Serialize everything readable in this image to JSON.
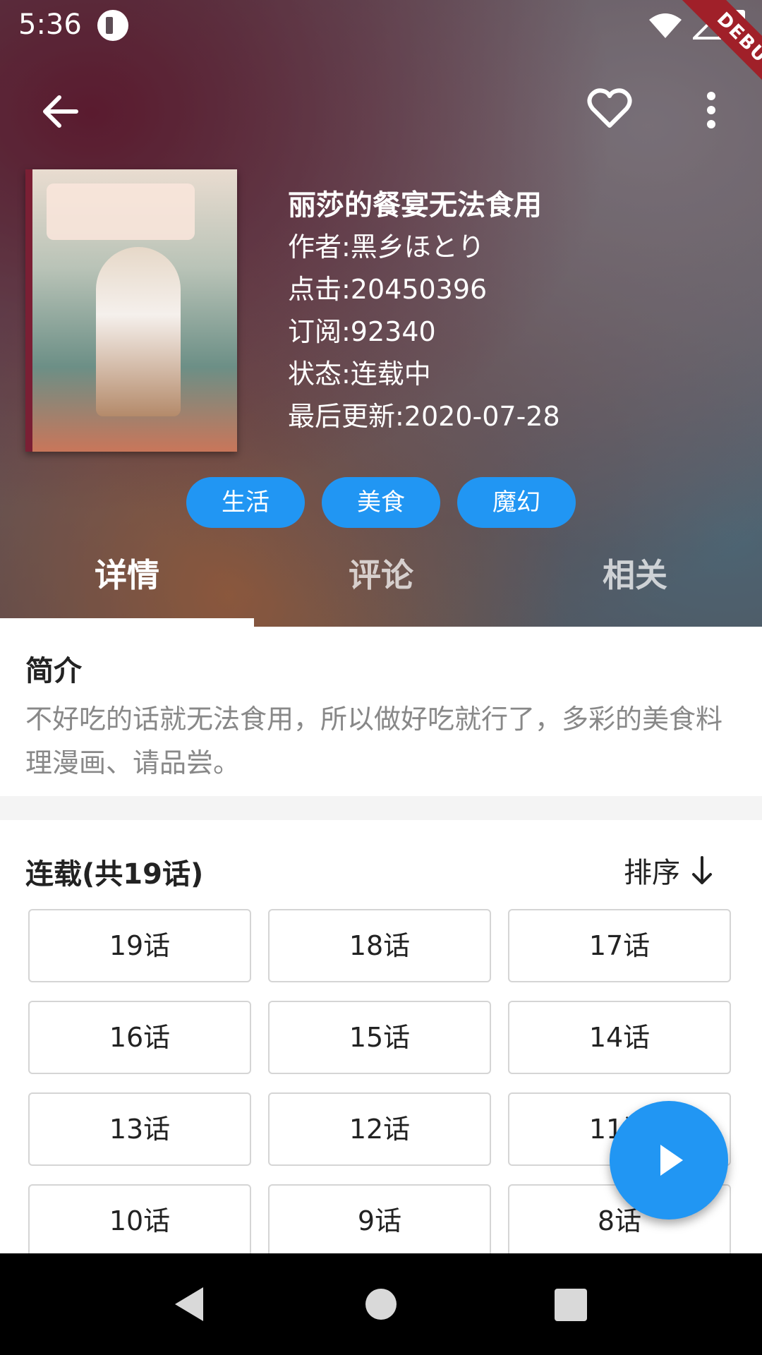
{
  "status_bar": {
    "time": "5:36",
    "debug_label": "DEBUG"
  },
  "app_bar": {
    "back_icon": "arrow-left-icon",
    "favorite_icon": "heart-outline-icon",
    "more_icon": "more-vert-icon"
  },
  "comic": {
    "title": "丽莎的餐宴无法食用",
    "author": "作者:黑乡ほとり",
    "clicks": "点击:20450396",
    "subscriptions": "订阅:92340",
    "status": "状态:连载中",
    "last_update": "最后更新:2020-07-28"
  },
  "tags": [
    "生活",
    "美食",
    "魔幻"
  ],
  "tabs": [
    {
      "label": "详情",
      "active": true
    },
    {
      "label": "评论",
      "active": false
    },
    {
      "label": "相关",
      "active": false
    }
  ],
  "synopsis": {
    "heading": "简介",
    "text": "不好吃的话就无法食用，所以做好吃就行了，多彩的美食料理漫画、请品尝。"
  },
  "chapters": {
    "heading": "连载(共19话)",
    "sort_label": "排序",
    "sort_icon": "arrow-down-icon",
    "items": [
      "19话",
      "18话",
      "17话",
      "16话",
      "15话",
      "14话",
      "13话",
      "12话",
      "11话",
      "10话",
      "9话",
      "8话"
    ]
  },
  "fab": {
    "icon": "play-icon"
  },
  "colors": {
    "accent": "#2196f3",
    "ribbon": "#a02029"
  }
}
